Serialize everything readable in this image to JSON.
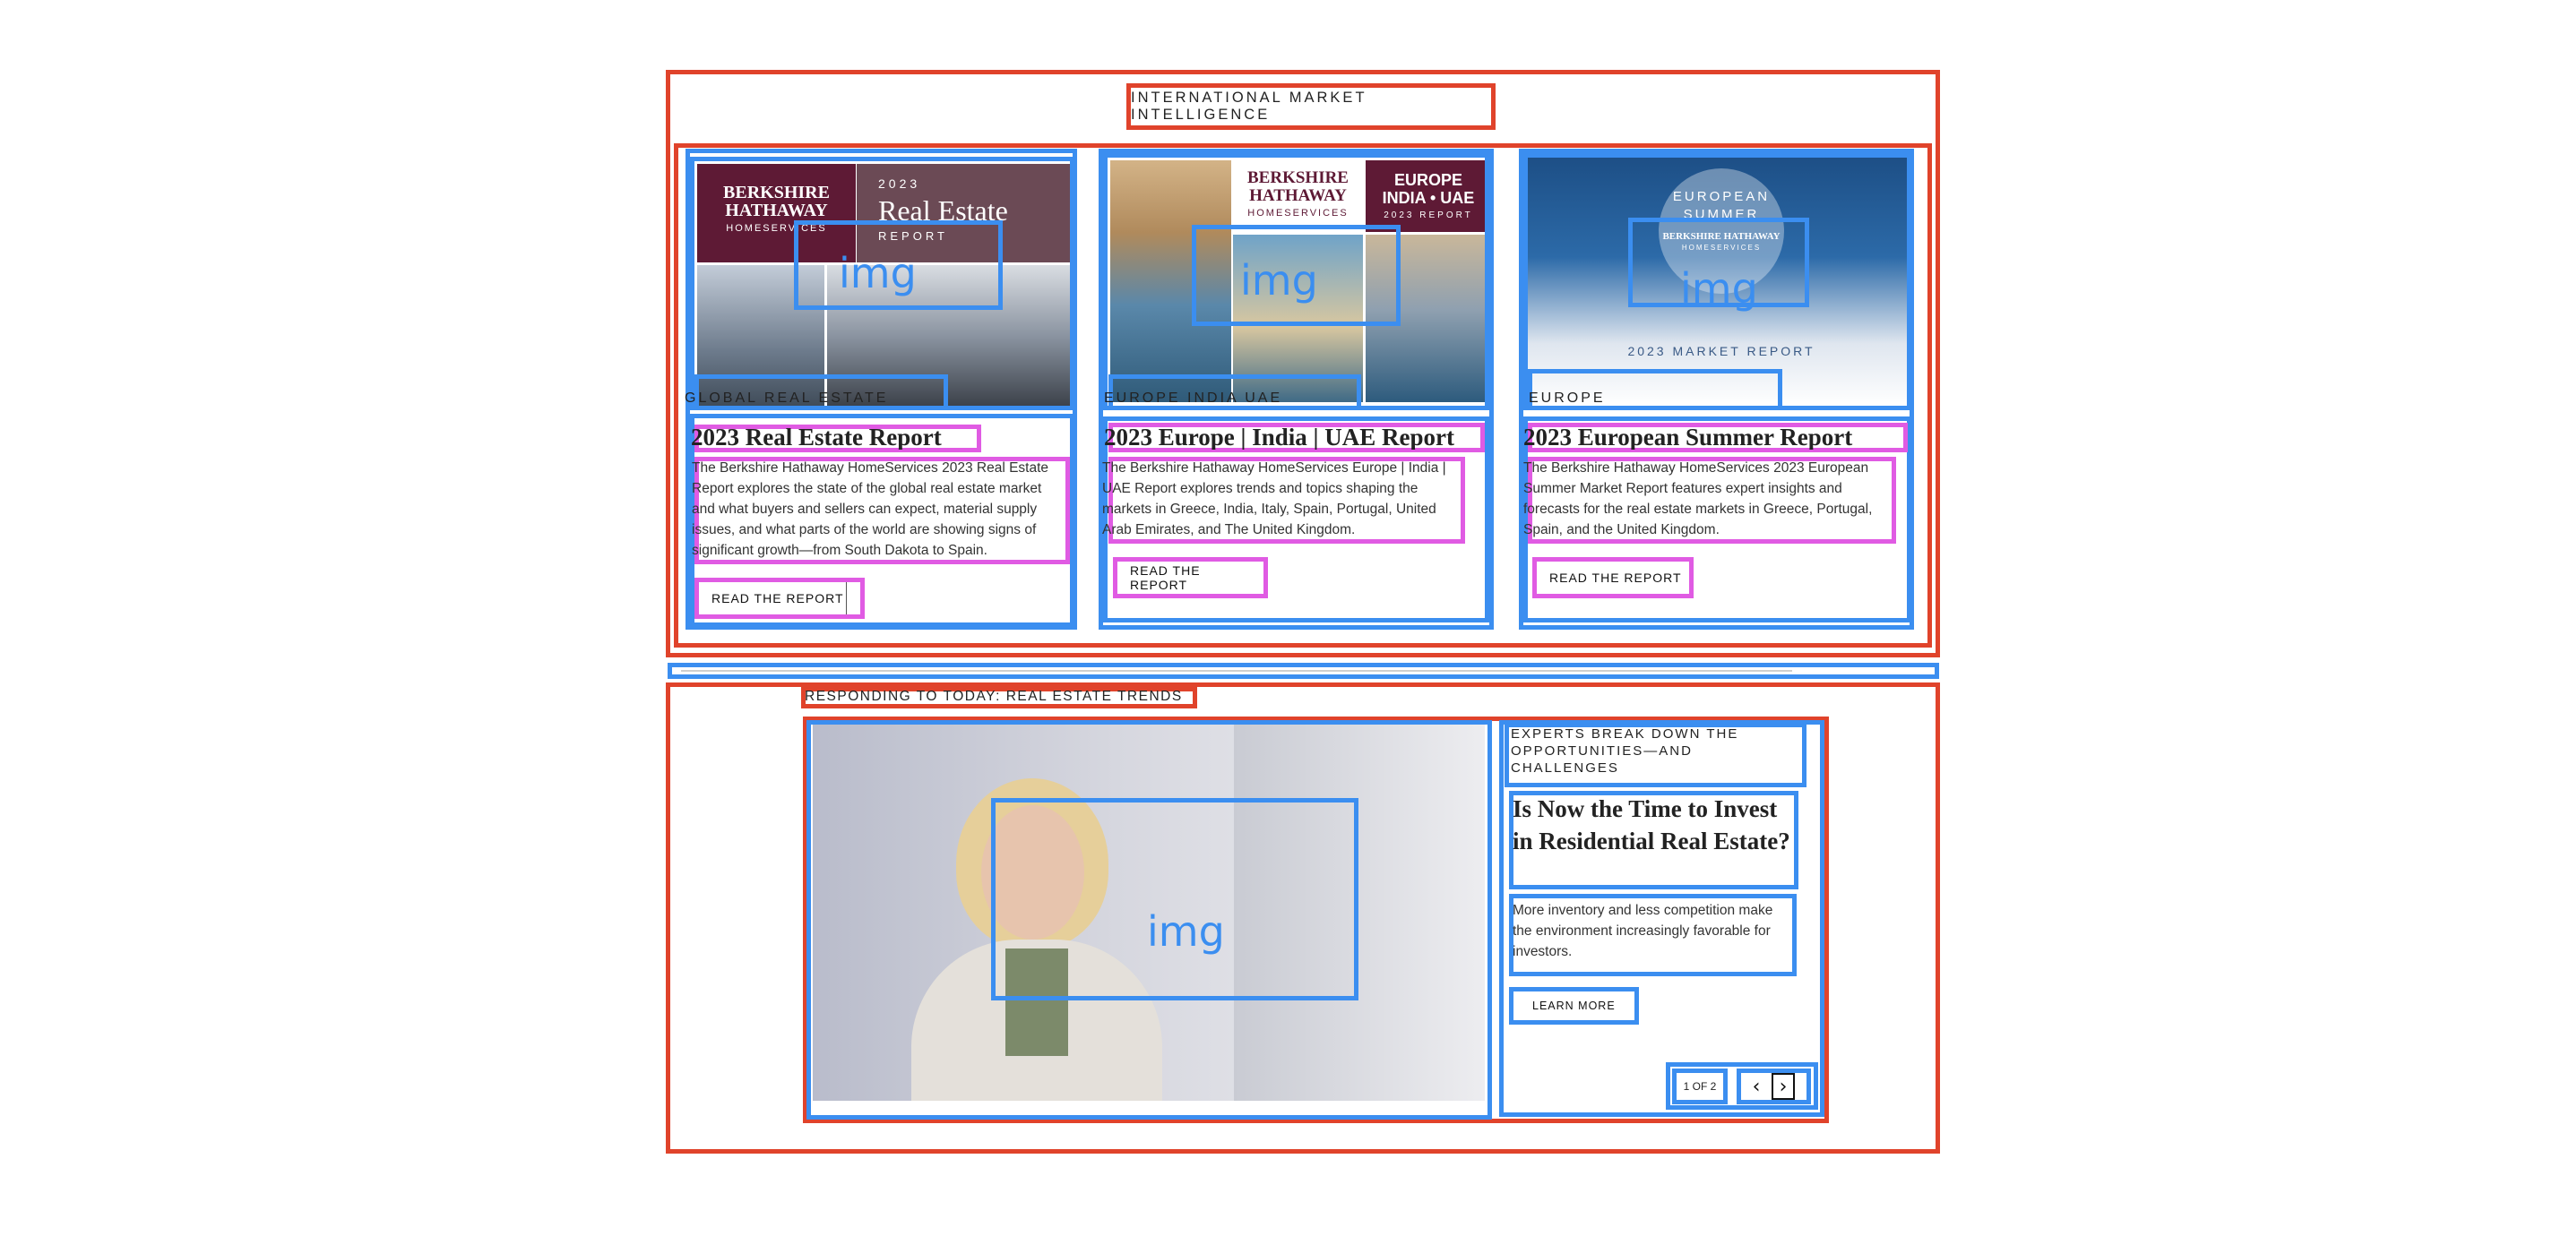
{
  "section1": {
    "heading": "INTERNATIONAL MARKET INTELLIGENCE",
    "img_label": "img",
    "cards": [
      {
        "kicker": "GLOBAL REAL ESTATE",
        "title": "2023 Real Estate Report",
        "description": "The Berkshire Hathaway HomeServices 2023 Real Estate Report explores the state of the global real estate market and what buyers and sellers can expect, material supply issues, and what parts of the world are showing signs of significant growth—from South Dakota to Spain.",
        "button": "READ THE REPORT",
        "image": {
          "brand": "BERKSHIRE HATHAWAY",
          "brand_sub": "HOMESERVICES",
          "year": "2023",
          "headline": "Real Estate",
          "headline_sub": "REPORT"
        }
      },
      {
        "kicker": "EUROPE INDIA UAE",
        "title": "2023 Europe | India | UAE Report",
        "description": "The Berkshire Hathaway HomeServices Europe | India | UAE Report explores trends and topics shaping the markets in Greece, India, Italy, Spain, Portugal, United Arab Emirates, and The United Kingdom.",
        "button": "READ THE REPORT",
        "image": {
          "brand": "BERKSHIRE HATHAWAY",
          "brand_sub": "HOMESERVICES",
          "headline": "EUROPE INDIA • UAE",
          "headline_sub": "2023 REPORT"
        }
      },
      {
        "kicker": "EUROPE",
        "title": "2023 European Summer Report",
        "description": "The Berkshire Hathaway HomeServices 2023 European Summer Market Report features expert insights and forecasts for the real estate markets in Greece, Portugal, Spain, and the United Kingdom.",
        "button": "READ THE REPORT",
        "image": {
          "headline": "EUROPEAN SUMMER",
          "brand": "BERKSHIRE HATHAWAY",
          "brand_sub": "HOMESERVICES",
          "footer": "2023 MARKET REPORT"
        }
      }
    ]
  },
  "section2": {
    "heading": "RESPONDING TO TODAY: REAL ESTATE TRENDS",
    "img_label": "img",
    "kicker": "EXPERTS BREAK DOWN THE OPPORTUNITIES—AND CHALLENGES",
    "title": "Is Now the Time to Invest in Residential Real Estate?",
    "description": "More inventory and less competition make the environment increasingly favorable for investors.",
    "button": "LEARN MORE",
    "pager": "1 OF 2",
    "prev_icon": "chevron-left-icon",
    "next_icon": "chevron-right-icon"
  }
}
